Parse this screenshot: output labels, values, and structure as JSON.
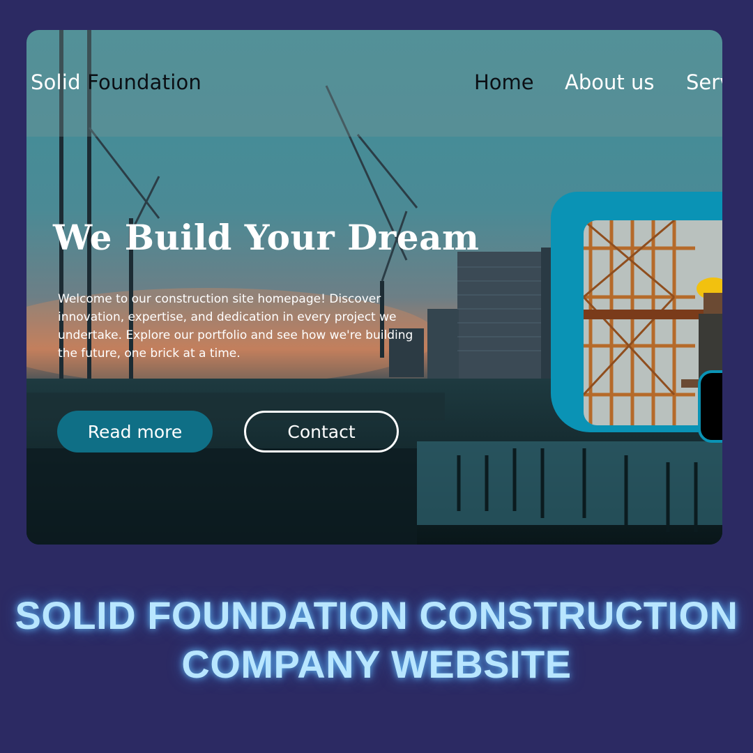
{
  "nav": {
    "brand_part1": "Solid ",
    "brand_part2": "Foundation",
    "links": [
      "Home",
      "About us",
      "Serv"
    ]
  },
  "hero": {
    "title": "We Build Your Dream",
    "description": "Welcome to our construction site homepage! Discover innovation, expertise, and dedication in every project we undertake. Explore our portfolio and see how we're building the future, one brick at a time."
  },
  "buttons": {
    "read_more": "Read more",
    "contact": "Contact"
  },
  "caption": {
    "line1": "SOLID FOUNDATION CONSTRUCTION",
    "line2": "COMPANY WEBSITE"
  },
  "colors": {
    "page_background": "#2c2a63",
    "accent_teal": "#0a93b5",
    "button_primary": "#0f6f86",
    "caption_glow": "#b8e6ff"
  },
  "icons": {
    "hero_image": "construction-site-cranes-photo",
    "worker_image": "construction-worker-hardhat-photo"
  }
}
